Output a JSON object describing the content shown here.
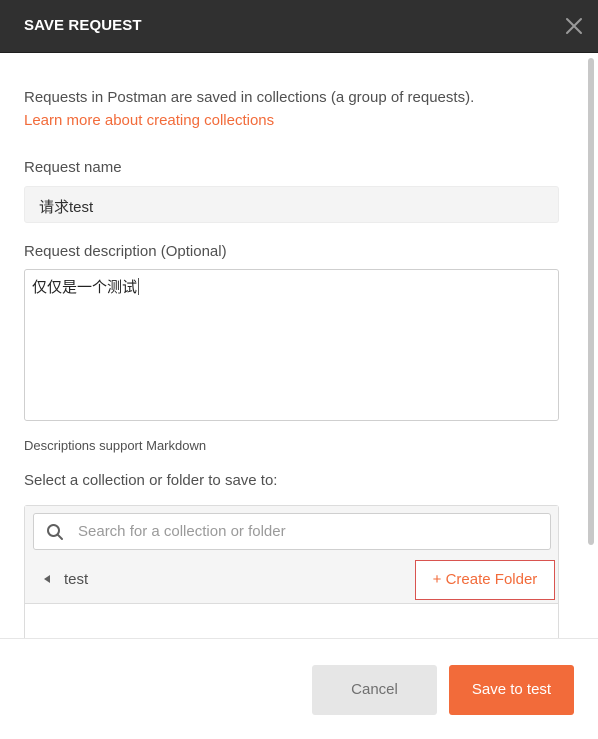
{
  "header": {
    "title": "SAVE REQUEST",
    "close_icon": "close-icon"
  },
  "intro": {
    "text": "Requests in Postman are saved in collections (a group of requests).",
    "link": "Learn more about creating collections"
  },
  "request_name": {
    "label": "Request name",
    "value": "请求test"
  },
  "request_description": {
    "label": "Request description (Optional)",
    "value": "仅仅是一个测试",
    "note": "Descriptions support Markdown"
  },
  "collection_picker": {
    "label": "Select a collection or folder to save to:",
    "search_placeholder": "Search for a collection or folder",
    "search_icon": "search-icon",
    "current": "test",
    "create_folder": "+ Create Folder"
  },
  "footer": {
    "cancel": "Cancel",
    "save": "Save to test"
  },
  "colors": {
    "accent": "#f26b3a",
    "header_bg": "#303030",
    "create_folder_border": "#d9534f"
  }
}
